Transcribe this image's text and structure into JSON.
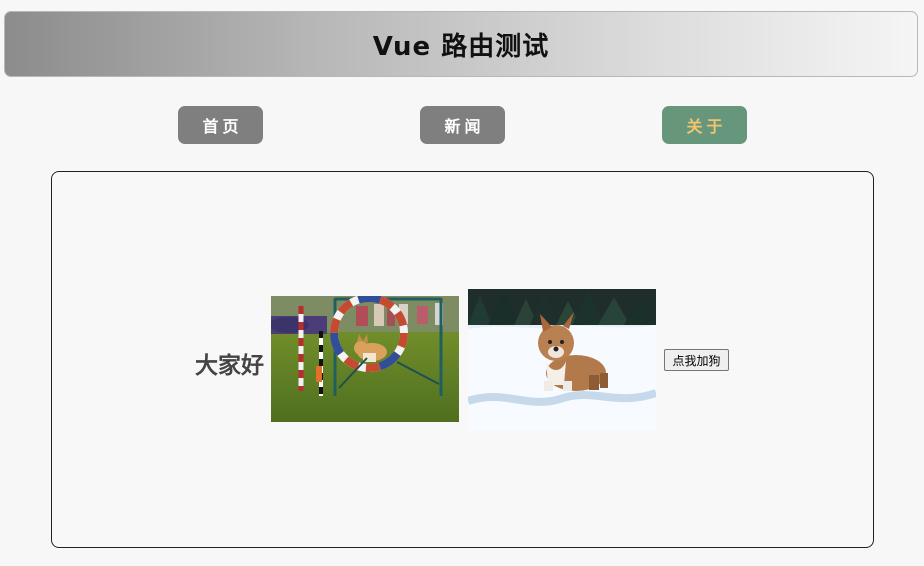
{
  "header": {
    "title": "Vue 路由测试"
  },
  "nav": {
    "items": [
      {
        "label": "首页",
        "active": false
      },
      {
        "label": "新闻",
        "active": false
      },
      {
        "label": "关于",
        "active": true
      }
    ]
  },
  "content": {
    "greeting": "大家好",
    "images": [
      {
        "subject": "corgi jumping through agility hoop"
      },
      {
        "subject": "corgi standing in snow"
      }
    ],
    "button_label": "点我加狗"
  },
  "colors": {
    "nav_default": "#7f7f7f",
    "nav_active": "#66977c",
    "nav_active_text": "#f4c36b"
  }
}
